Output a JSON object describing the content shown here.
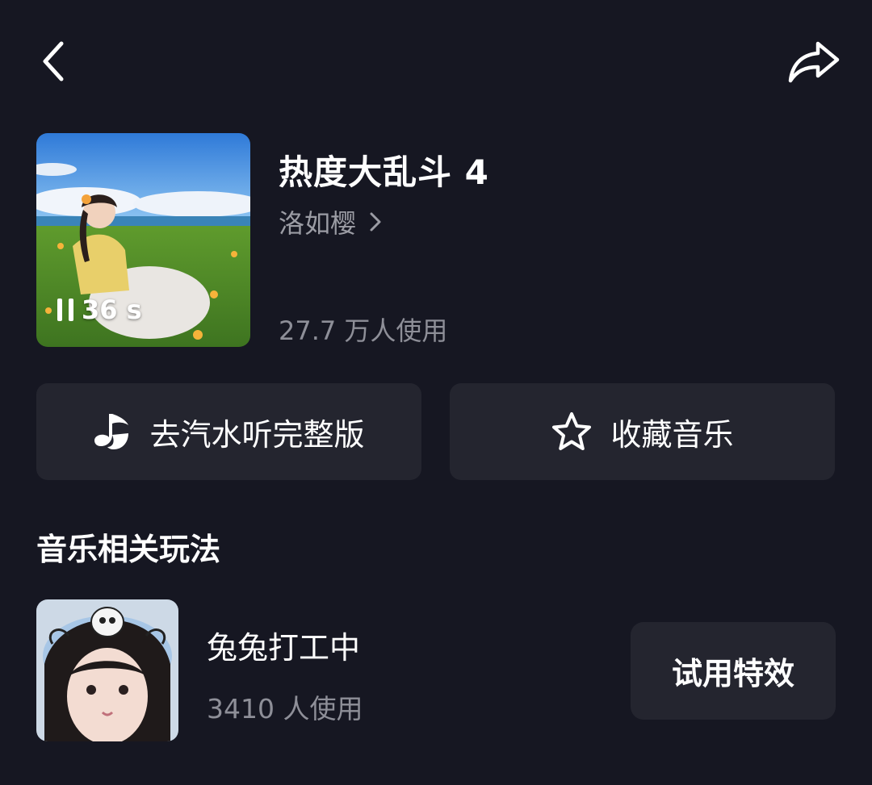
{
  "header": {
    "back_icon": "chevron-left-icon",
    "share_icon": "share-arrow-icon"
  },
  "song": {
    "title": "热度大乱斗 4",
    "artist": "洛如樱",
    "artist_icon": "chevron-right-icon",
    "usage": "27.7 万人使用",
    "duration_label": "36 s",
    "play_state_icon": "pause-icon"
  },
  "actions": {
    "qishui_label": "去汽水听完整版",
    "qishui_icon": "music-note-icon",
    "favorite_label": "收藏音乐",
    "favorite_icon": "star-outline-icon"
  },
  "related": {
    "section_title": "音乐相关玩法",
    "items": [
      {
        "name": "兔兔打工中",
        "usage": "3410 人使用",
        "button_label": "试用特效"
      }
    ]
  },
  "colors": {
    "background": "#161722",
    "card": "#24252f",
    "secondary_text": "#9b9ca4"
  }
}
